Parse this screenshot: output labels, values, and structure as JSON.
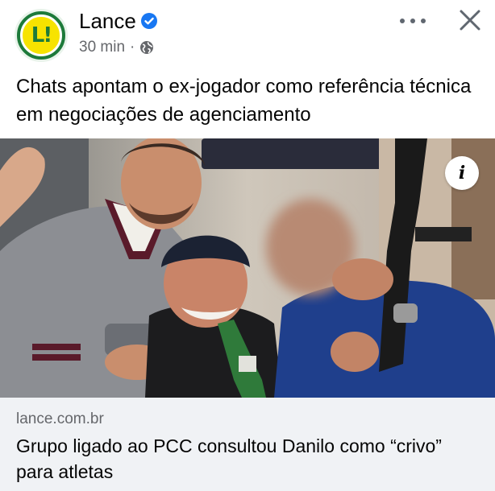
{
  "post": {
    "page_name": "Lance",
    "avatar_text": "L!",
    "timestamp": "30 min",
    "separator": "·",
    "privacy_icon": "globe-icon",
    "verified_icon": "verified-badge-icon",
    "caption": "Chats apontam o ex-jogador como referência técnica em negociações de agenciamento"
  },
  "actions": {
    "more_icon": "more-horizontal-icon",
    "close_icon": "close-icon",
    "info_icon": "info-icon",
    "info_glyph": "i"
  },
  "link_preview": {
    "domain": "lance.com.br",
    "title": "Grupo ligado ao PCC consultou Danilo como “crivo” para atletas"
  },
  "colors": {
    "verified": "#1877f2",
    "secondary_text": "#65676b",
    "link_bg": "#f0f2f5",
    "brand_green": "#1d7a3a",
    "brand_yellow": "#f7e300"
  }
}
